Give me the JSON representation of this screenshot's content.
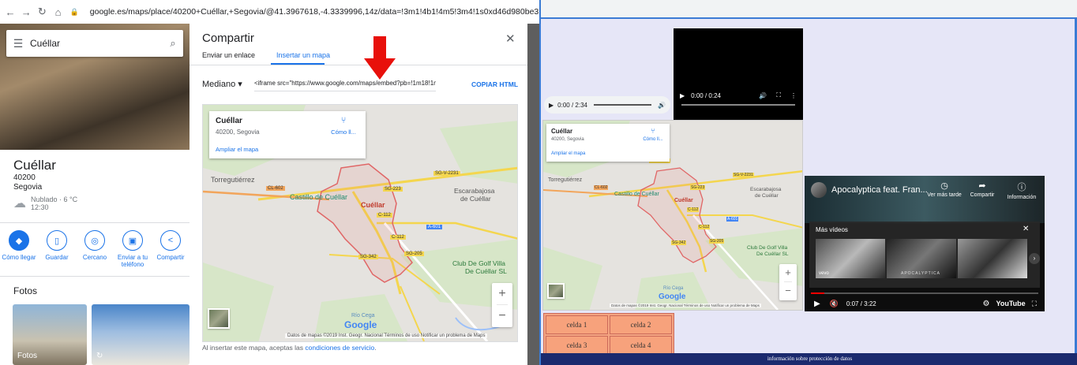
{
  "browser": {
    "url": "google.es/maps/place/40200+Cuéllar,+Segovia/@41.3967618,-4.3339996,14z/data=!3m1!4b1!4m5!3m4!1s0xd46d980be3b754d:0x2631df"
  },
  "left_panel": {
    "search_value": "Cuéllar",
    "place_name": "Cuéllar",
    "postal_code": "40200",
    "province": "Segovia",
    "weather_condition": "Nublado · 6 °C",
    "weather_time": "12:30",
    "actions": [
      {
        "label": "Cómo llegar",
        "icon": "directions-icon"
      },
      {
        "label": "Guardar",
        "icon": "bookmark-icon"
      },
      {
        "label": "Cercano",
        "icon": "nearby-icon"
      },
      {
        "label": "Enviar a tu teléfono",
        "icon": "phone-icon"
      },
      {
        "label": "Compartir",
        "icon": "share-icon"
      }
    ],
    "photos_title": "Fotos",
    "photo_caption_1": "Fotos",
    "photo_caption_2": "↻"
  },
  "share_dialog": {
    "title": "Compartir",
    "close": "✕",
    "tabs": [
      "Enviar un enlace",
      "Insertar un mapa"
    ],
    "active_tab": 1,
    "size": "Mediano ▾",
    "iframe_code": "<iframe src=\"https://www.google.com/maps/embed?pb=!1m18!1m",
    "copy_label": "COPIAR HTML",
    "footer_text": "Al insertar este mapa, aceptas las ",
    "footer_link": "condiciones de servicio",
    "footer_end": "."
  },
  "map": {
    "place_name": "Cuéllar",
    "place_addr": "40200, Segovia",
    "directions": "Cómo ll...",
    "enlarge": "Ampliar el mapa",
    "labels": {
      "torregutierrez": "Torregutiérrez",
      "castillo": "Castillo de Cuéllar",
      "cuellar": "Cuéllar",
      "escarabajosa": "Escarabajosa",
      "de_cuellar": "de Cuéllar",
      "golf": "Club De Golf Villa",
      "golf2": "De Cuéllar SL",
      "google": "Google",
      "rio": "Río Cega"
    },
    "roads": {
      "sgp2041": "SG-P-2041",
      "sg223": "SG-223",
      "sg2231": "SG-V-2231",
      "cl602": "CL-602",
      "c112a": "C-112",
      "c112b": "C-112",
      "a601": "A-601",
      "sg205": "SG-205",
      "sg342": "SG-342"
    },
    "attribution": "Datos de mapas ©2019 Inst. Geogr. Nacional    Términos de uso    Notificar un problema de Maps",
    "attribution_small": "Datos de mapas ©2019 Inst. Geogr. Nacional   Términos de uso   Notificar un problema de Maps",
    "zoom_in": "+",
    "zoom_out": "−"
  },
  "right_page": {
    "video_time": "0:00 / 0:24",
    "audio_time": "0:00 / 2:34",
    "youtube": {
      "title": "Apocalyptica feat. Fran...",
      "watch_later": "Ver más tarde",
      "share": "Compartir",
      "info": "Información",
      "more_videos": "Más vídeos",
      "time": "0:07 / 3:22",
      "brand": "YouTube",
      "vevo": "vevo",
      "apoc": "APOCALYPTICA"
    },
    "table": [
      [
        "celda 1",
        "celda 2"
      ],
      [
        "celda 3",
        "celda 4"
      ]
    ],
    "footer": "información sobre protección de datos"
  },
  "colors": {
    "accent_blue": "#1a73e8",
    "arrow_red": "#e8100b",
    "footer_navy": "#1b2a6e",
    "cell_orange": "#f7a27c",
    "page_lavender": "#e6e6f7"
  }
}
